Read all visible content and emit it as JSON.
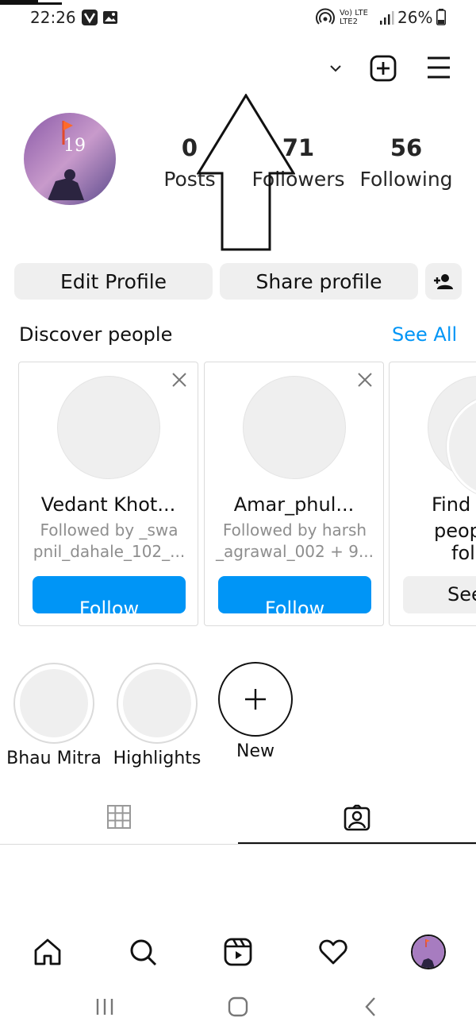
{
  "status_bar": {
    "time": "22:26",
    "network": "Vo) LTE\nLTE2",
    "battery": "26%"
  },
  "header": {
    "username": "___",
    "account_switcher": "_____"
  },
  "profile": {
    "stats": [
      {
        "value": "0",
        "label": "Posts"
      },
      {
        "value": "71",
        "label": "Followers"
      },
      {
        "value": "56",
        "label": "Following"
      }
    ],
    "edit_label": "Edit Profile",
    "share_label": "Share profile"
  },
  "discover": {
    "title": "Discover people",
    "see_all": "See All",
    "cards": [
      {
        "name": "Vedant Khot...",
        "sub1": "Followed by _swa",
        "sub2": "pnil_dahale_102_...",
        "button": "Follow"
      },
      {
        "name": "Amar_phul...",
        "sub1": "Followed by harsh",
        "sub2": "_agrawal_002 + 9...",
        "button": "Follow"
      },
      {
        "name": "Find",
        "sub1": "peop",
        "sub2": "fol",
        "button": "See"
      }
    ]
  },
  "highlights": [
    {
      "label": "Bhau Mitra"
    },
    {
      "label": "Highlights"
    },
    {
      "label": "New"
    }
  ],
  "colors": {
    "accent": "#0095f6",
    "pill_bg": "#efefef"
  }
}
